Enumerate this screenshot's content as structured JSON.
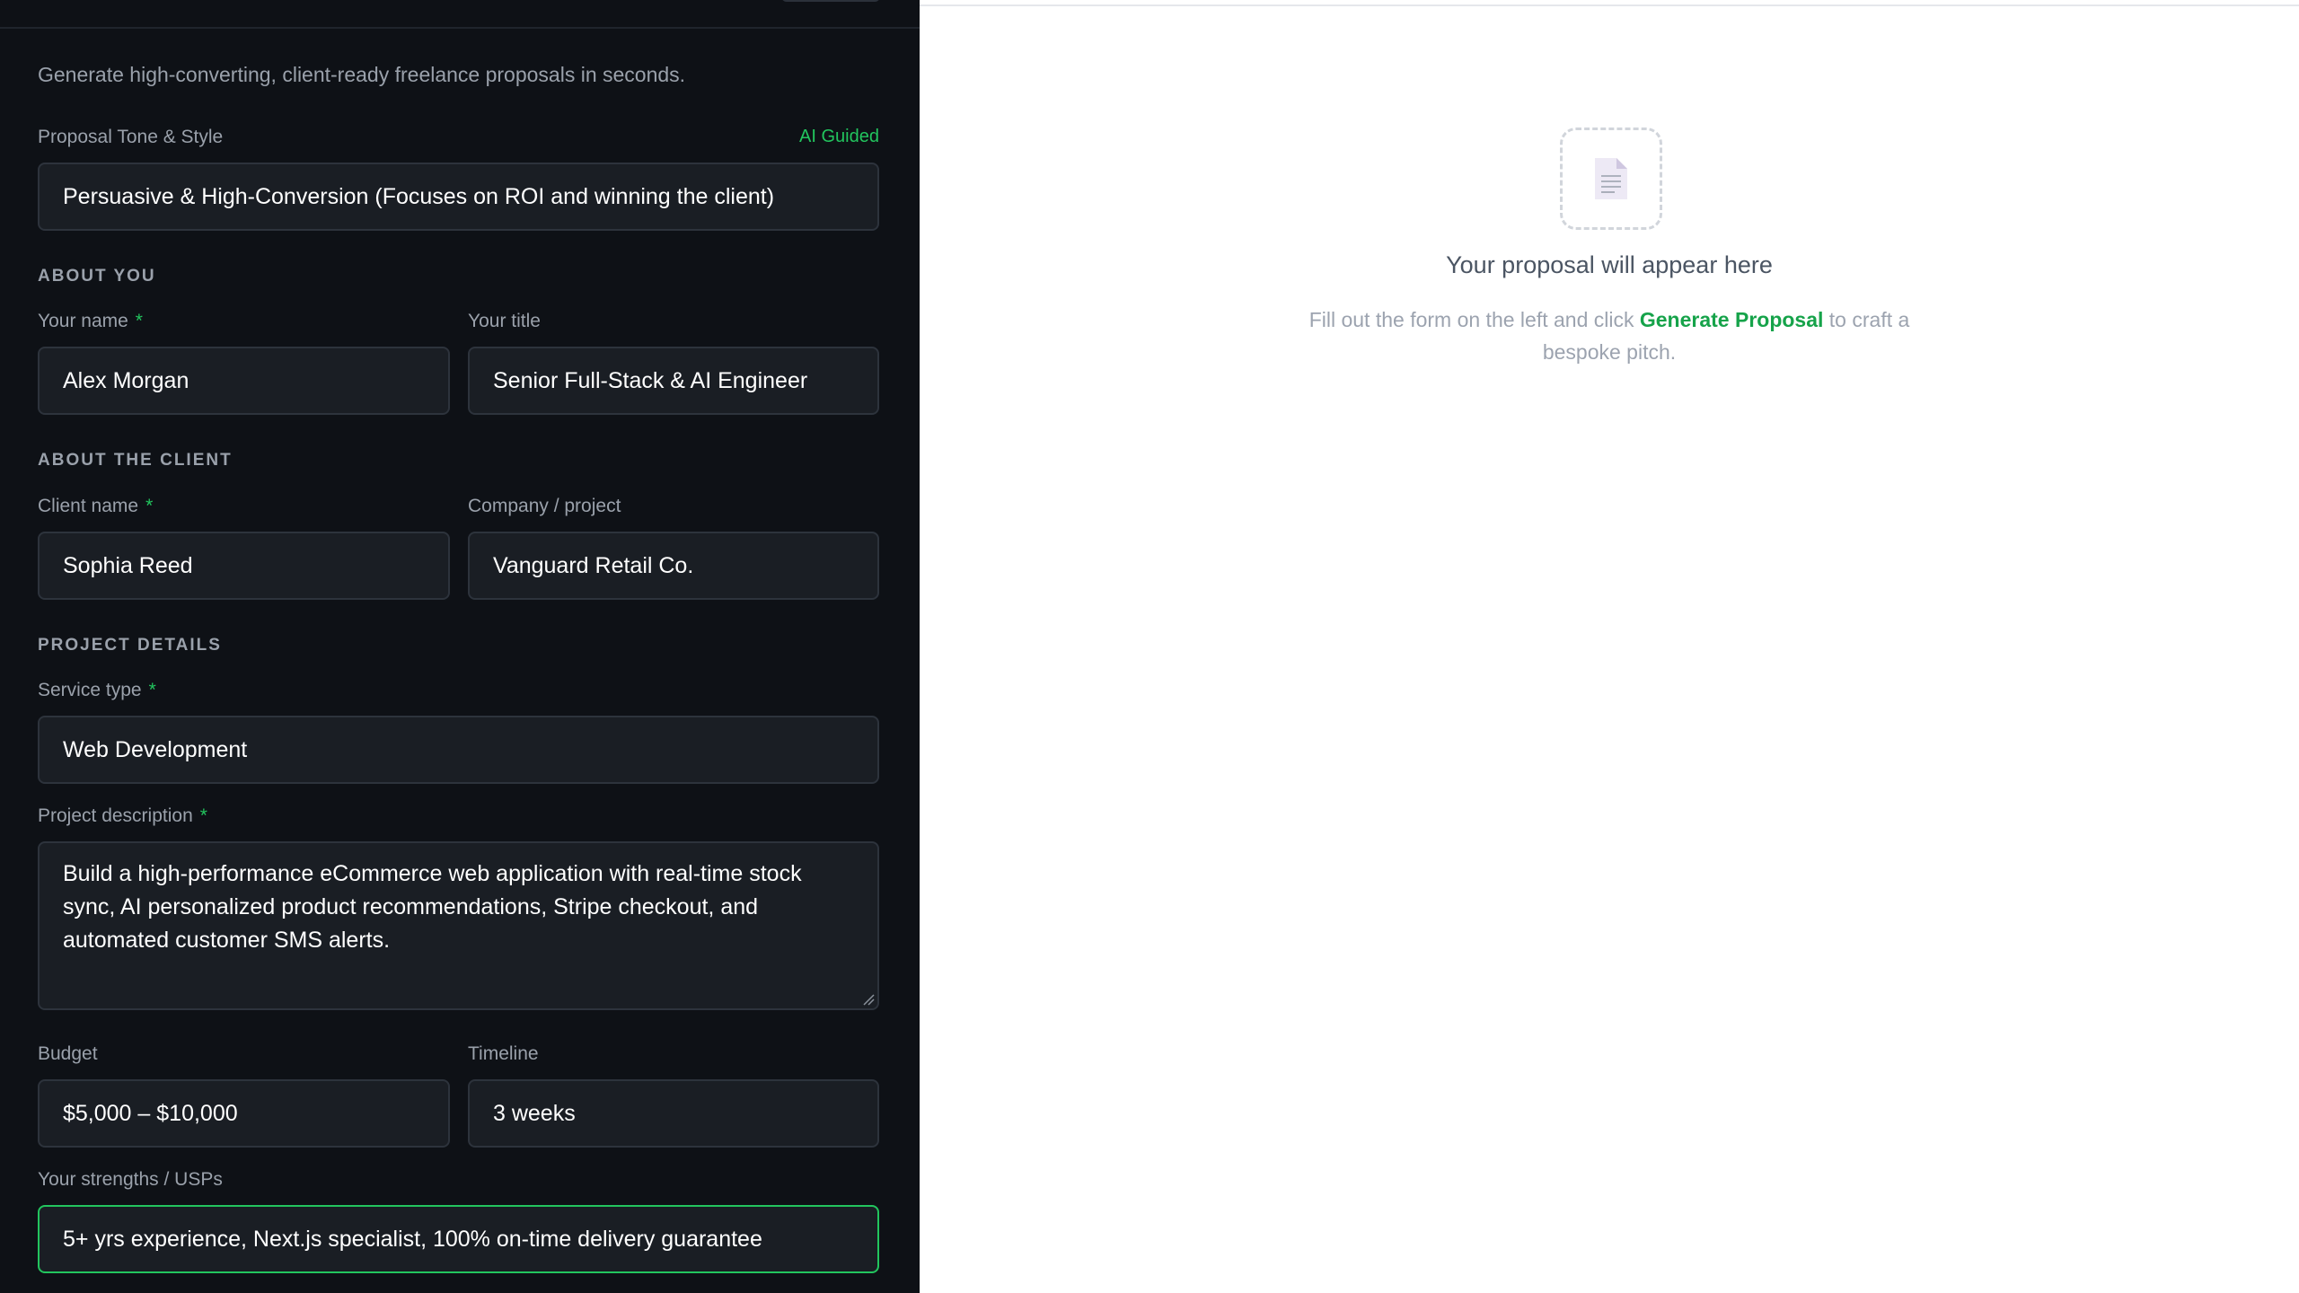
{
  "form": {
    "subtitle": "Generate high-converting, client-ready freelance proposals in seconds.",
    "tone": {
      "label": "Proposal Tone & Style",
      "badge": "AI Guided",
      "value": "Persuasive & High-Conversion (Focuses on ROI and winning the client)"
    },
    "about_you": {
      "heading": "ABOUT YOU",
      "name_label": "Your name",
      "name_value": "Alex Morgan",
      "title_label": "Your title",
      "title_value": "Senior Full-Stack & AI Engineer"
    },
    "about_client": {
      "heading": "ABOUT THE CLIENT",
      "client_label": "Client name",
      "client_value": "Sophia Reed",
      "company_label": "Company / project",
      "company_value": "Vanguard Retail Co."
    },
    "project": {
      "heading": "PROJECT DETAILS",
      "service_label": "Service type",
      "service_value": "Web Development",
      "description_label": "Project description",
      "description_value": "Build a high-performance eCommerce web application with real-time stock sync, AI personalized product recommendations, Stripe checkout, and automated customer SMS alerts.",
      "budget_label": "Budget",
      "budget_value": "$5,000 – $10,000",
      "timeline_label": "Timeline",
      "timeline_value": "3 weeks",
      "strengths_label": "Your strengths / USPs",
      "strengths_value": "5+ yrs experience, Next.js specialist, 100% on-time delivery guarantee"
    },
    "required_marker": "*"
  },
  "preview": {
    "empty_title": "Your proposal will appear here",
    "desc_before": "Fill out the form on the left and click ",
    "desc_link": "Generate Proposal",
    "desc_after": " to craft a bespoke pitch.",
    "icon": "document-icon"
  },
  "colors": {
    "panel_bg": "#0e1116",
    "field_bg": "#1a1e24",
    "accent": "#22c55e",
    "link": "#16a34a"
  }
}
